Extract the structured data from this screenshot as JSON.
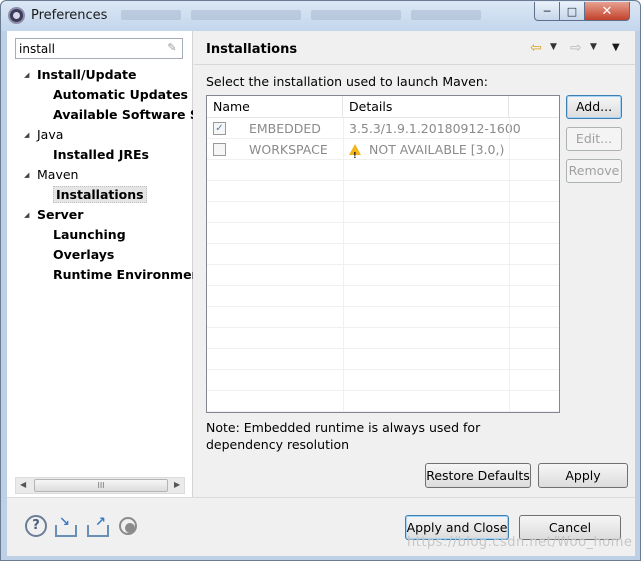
{
  "window": {
    "title": "Preferences",
    "minimize": "─",
    "maximize": "□",
    "close": "✕"
  },
  "sidebar": {
    "filter_value": "install",
    "tree": [
      {
        "label": "Install/Update",
        "level": 0,
        "bold": true,
        "expanded": true
      },
      {
        "label": "Automatic Updates",
        "level": 1,
        "bold": true
      },
      {
        "label": "Available Software Si",
        "level": 1,
        "bold": true
      },
      {
        "label": "Java",
        "level": 0,
        "bold": false,
        "expanded": true
      },
      {
        "label": "Installed JREs",
        "level": 1,
        "bold": true
      },
      {
        "label": "Maven",
        "level": 0,
        "bold": false,
        "expanded": true
      },
      {
        "label": "Installations",
        "level": 1,
        "bold": true,
        "selected": true
      },
      {
        "label": "Server",
        "level": 0,
        "bold": true,
        "expanded": true
      },
      {
        "label": "Launching",
        "level": 1,
        "bold": true
      },
      {
        "label": "Overlays",
        "level": 1,
        "bold": true
      },
      {
        "label": "Runtime Environmen",
        "level": 1,
        "bold": true
      }
    ],
    "scroll_grip": "III"
  },
  "page": {
    "title": "Installations",
    "instruction": "Select the installation used to launch Maven:",
    "table": {
      "columns": [
        "Name",
        "Details"
      ],
      "rows": [
        {
          "checked": true,
          "name": "EMBEDDED",
          "details": "3.5.3/1.9.1.20180912-1600",
          "warning": false
        },
        {
          "checked": false,
          "name": "WORKSPACE",
          "details": "NOT AVAILABLE [3.0,)",
          "warning": true
        }
      ]
    },
    "buttons": {
      "add": "Add...",
      "edit": "Edit...",
      "remove": "Remove"
    },
    "note": "Note: Embedded runtime is always used for dependency resolution",
    "restore_defaults": "Restore Defaults",
    "apply": "Apply"
  },
  "footer": {
    "apply_and_close": "Apply and Close",
    "cancel": "Cancel",
    "icons": [
      "help-icon",
      "import-icon",
      "export-icon",
      "record-icon"
    ]
  },
  "watermark": "https://blog.csdn.net/Woo_home",
  "colors": {
    "accent": "#3c7fb1",
    "warning": "#f2b51a",
    "nav_arrow": "#d9a520"
  }
}
